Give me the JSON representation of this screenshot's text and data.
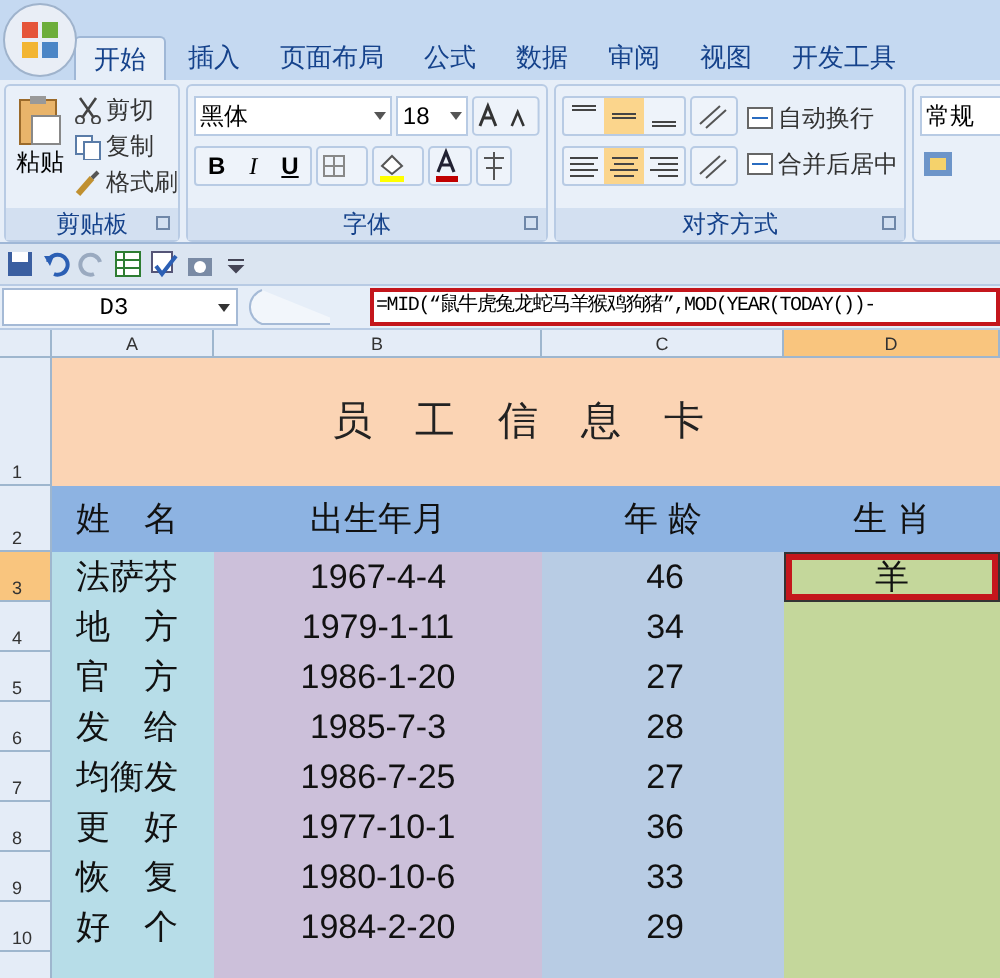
{
  "tabs": [
    {
      "label": "开始",
      "selected": true
    },
    {
      "label": "插入",
      "selected": false
    },
    {
      "label": "页面布局",
      "selected": false
    },
    {
      "label": "公式",
      "selected": false
    },
    {
      "label": "数据",
      "selected": false
    },
    {
      "label": "审阅",
      "selected": false
    },
    {
      "label": "视图",
      "selected": false
    },
    {
      "label": "开发工具",
      "selected": false
    }
  ],
  "clipboard": {
    "paste": "粘贴",
    "cut": "剪切",
    "copy": "复制",
    "format_painter": "格式刷",
    "label": "剪贴板"
  },
  "font": {
    "name": "黑体",
    "size": "18",
    "bold": "B",
    "italic": "I",
    "underline": "U",
    "label": "字体"
  },
  "alignment": {
    "vertical": [
      {
        "selected": false
      },
      {
        "selected": true
      },
      {
        "selected": false
      }
    ],
    "horizontal": [
      {
        "selected": false
      },
      {
        "selected": true
      },
      {
        "selected": false
      }
    ],
    "wrap": "自动换行",
    "merge": "合并后居中",
    "label": "对齐方式"
  },
  "number": {
    "format": "常规"
  },
  "formula_bar": {
    "name_box": "D3",
    "formula": "=MID(“鼠牛虎兔龙蛇马羊猴鸡狗猪”,MOD(YEAR(TODAY())-"
  },
  "sheet": {
    "columns": [
      {
        "label": "A",
        "selected": false
      },
      {
        "label": "B",
        "selected": false
      },
      {
        "label": "C",
        "selected": false
      },
      {
        "label": "D",
        "selected": true
      }
    ],
    "title_row": {
      "number": "1",
      "text": "员 工 信 息 卡"
    },
    "header_row": {
      "number": "2",
      "cells": [
        "姓　名",
        "出生年月",
        "年 龄",
        "生 肖"
      ]
    },
    "rows": [
      {
        "number": "3",
        "selected": true,
        "cells": [
          "法萨芬",
          "1967-4-4",
          "46",
          "羊"
        ]
      },
      {
        "number": "4",
        "selected": false,
        "cells": [
          "地　方",
          "1979-1-11",
          "34"
        ]
      },
      {
        "number": "5",
        "selected": false,
        "cells": [
          "官　方",
          "1986-1-20",
          "27"
        ]
      },
      {
        "number": "6",
        "selected": false,
        "cells": [
          "发　给",
          "1985-7-3",
          "28"
        ]
      },
      {
        "number": "7",
        "selected": false,
        "cells": [
          "均衡发",
          "1986-7-25",
          "27"
        ]
      },
      {
        "number": "8",
        "selected": false,
        "cells": [
          "更　好",
          "1977-10-1",
          "36"
        ]
      },
      {
        "number": "9",
        "selected": false,
        "cells": [
          "恢　复",
          "1980-10-6",
          "33"
        ]
      },
      {
        "number": "10",
        "selected": false,
        "cells": [
          "好　个",
          "1984-2-20",
          "29"
        ]
      }
    ]
  }
}
